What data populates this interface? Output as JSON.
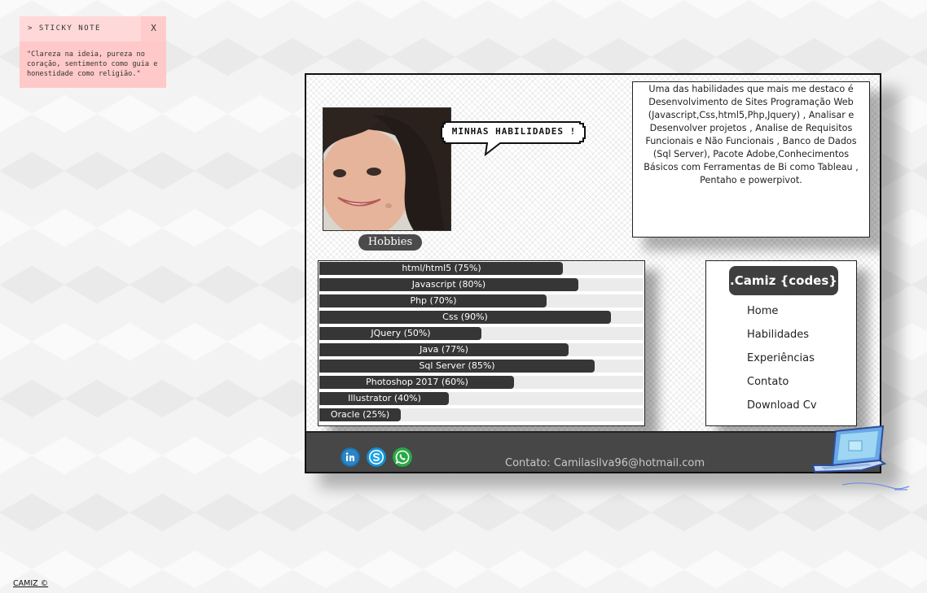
{
  "sticky_note": {
    "title": "> STICKY NOTE",
    "close_label": "X",
    "text": "\"Clareza na ideia, pureza no coração, sentimento como guia e honestidade como religião.\""
  },
  "profile": {
    "speech_bubble": "MINHAS HABILIDADES !",
    "hobbies_label": "Hobbies"
  },
  "description": "Uma das habilidades que mais me destaco é Desenvolvimento de Sites Programação Web (Javascript,Css,html5,Php,Jquery) , Analisar e Desenvolver projetos , Analise de Requisitos Funcionais e Não Funcionais , Banco de Dados (Sql Server), Pacote Adobe,Conhecimentos Básicos com Ferramentas de Bi como Tableau , Pentaho e powerpivot.",
  "skills": [
    {
      "label": "html/html5 (75%)",
      "percent": 75
    },
    {
      "label": "Javascript (80%)",
      "percent": 80
    },
    {
      "label": "Php (70%)",
      "percent": 70
    },
    {
      "label": "Css (90%)",
      "percent": 90
    },
    {
      "label": "JQuery (50%)",
      "percent": 50
    },
    {
      "label": "Java (77%)",
      "percent": 77
    },
    {
      "label": "Sql Server (85%)",
      "percent": 85
    },
    {
      "label": "Photoshop 2017 (60%)",
      "percent": 60
    },
    {
      "label": "Illustrator (40%)",
      "percent": 40
    },
    {
      "label": "Oracle (25%)",
      "percent": 25
    }
  ],
  "nav": {
    "brand": ".Camiz {codes}",
    "items": [
      "Home",
      "Habilidades",
      "Experiências",
      "Contato",
      "Download Cv"
    ]
  },
  "footer": {
    "social_icons": [
      "linkedin-icon",
      "skype-icon",
      "whatsapp-icon"
    ],
    "contact": "Contato: Camilasilva96@hotmail.com"
  },
  "page_footer": "CAMIZ ©",
  "colors": {
    "sticky_bg": "#ffc9c9",
    "bar_fill": "#363636",
    "bar_track": "#ebebeb",
    "footer_bg": "#474747",
    "brand_bg": "#3f3f3f"
  }
}
